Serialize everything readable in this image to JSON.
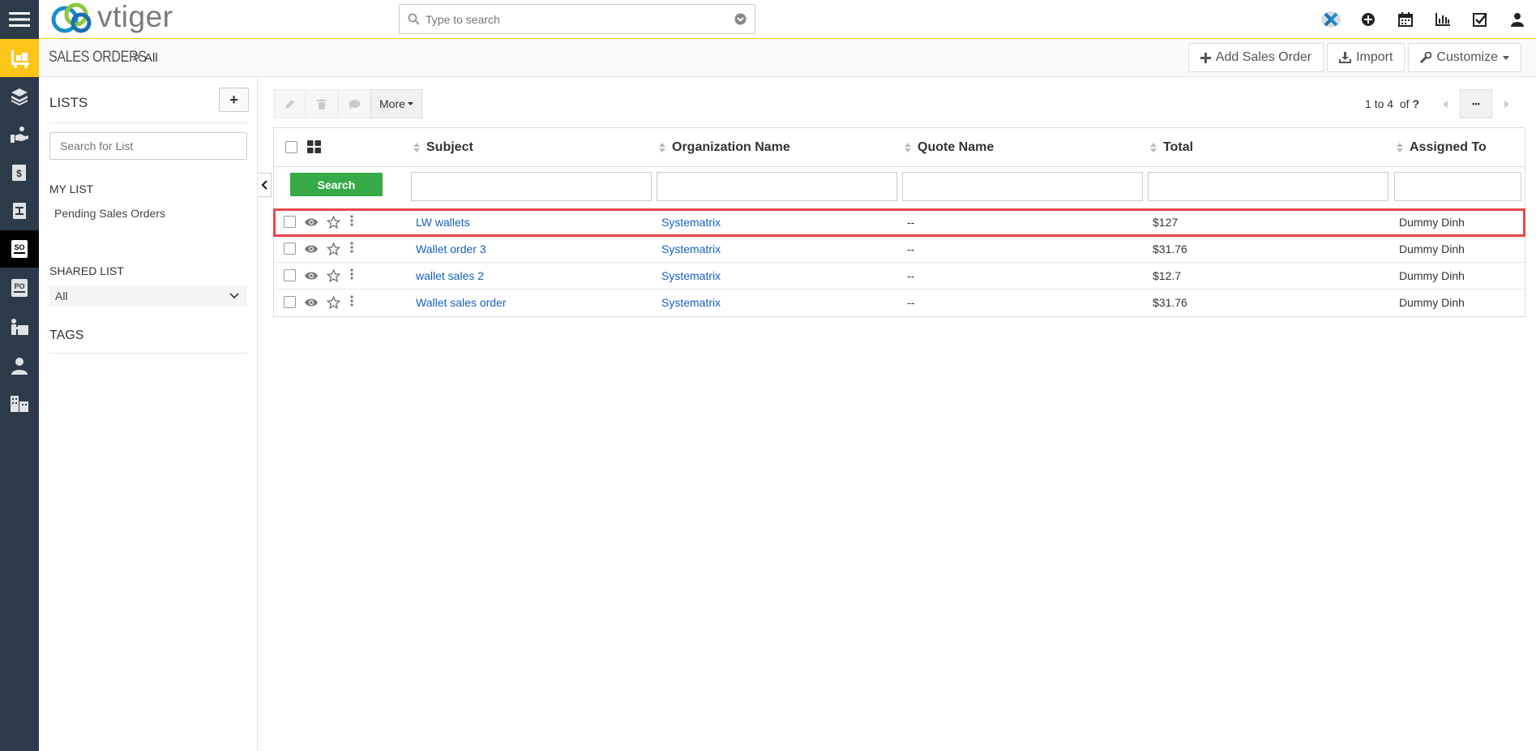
{
  "app": {
    "logo_text": "vtiger"
  },
  "search": {
    "placeholder": "Type to search"
  },
  "module": {
    "title": "SALES ORDERS",
    "separator": ">",
    "crumb": "All"
  },
  "actions": {
    "add": "Add Sales Order",
    "import": "Import",
    "customize": "Customize"
  },
  "lists": {
    "title": "LISTS",
    "add": "+",
    "search_placeholder": "Search for List",
    "my_list_label": "MY LIST",
    "my_list_items": [
      "Pending Sales Orders"
    ],
    "shared_list_label": "SHARED LIST",
    "shared_selected": "All",
    "tags_label": "TAGS"
  },
  "toolbar": {
    "more": "More"
  },
  "pager": {
    "range": "1 to 4",
    "of": "of",
    "total": "?",
    "more": "•••"
  },
  "table": {
    "columns": [
      "Subject",
      "Organization Name",
      "Quote Name",
      "Total",
      "Assigned To"
    ],
    "search_button": "Search",
    "rows": [
      {
        "subject": "LW wallets",
        "org": "Systematrix",
        "quote": "--",
        "total": "$127",
        "assigned": "Dummy Dinh",
        "selected": true
      },
      {
        "subject": "Wallet order 3",
        "org": "Systematrix",
        "quote": "--",
        "total": "$31.76",
        "assigned": "Dummy Dinh",
        "selected": false
      },
      {
        "subject": "wallet sales 2",
        "org": "Systematrix",
        "quote": "--",
        "total": "$12.7",
        "assigned": "Dummy Dinh",
        "selected": false
      },
      {
        "subject": "Wallet sales order",
        "org": "Systematrix",
        "quote": "--",
        "total": "$31.76",
        "assigned": "Dummy Dinh",
        "selected": false
      }
    ]
  },
  "colors": {
    "rail": "#2c3b49",
    "accent": "#fbc519",
    "search_green": "#35aa47",
    "link": "#1560bd",
    "highlight": "#e8474a"
  }
}
